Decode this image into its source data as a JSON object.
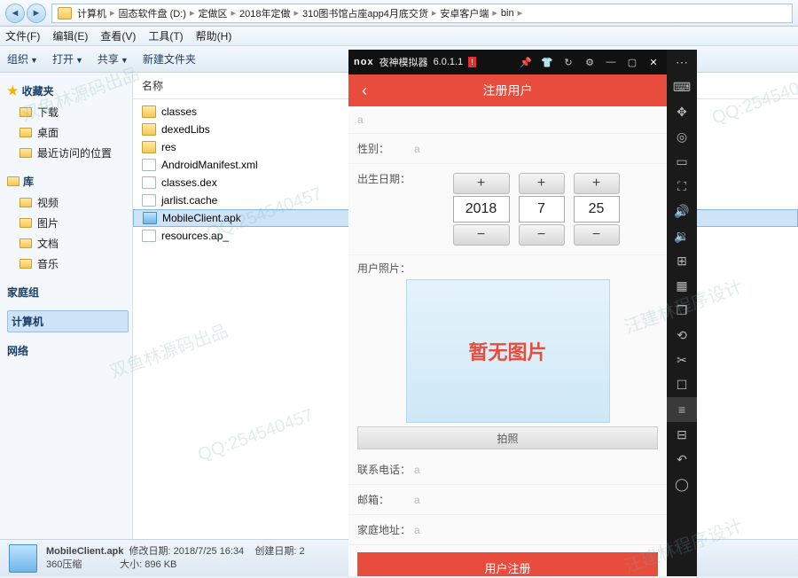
{
  "explorer": {
    "breadcrumbs": [
      "计算机",
      "固态软件盘 (D:)",
      "定做区",
      "2018年定做",
      "310图书馆占座app4月底交货",
      "安卓客户端",
      "bin"
    ],
    "menu": {
      "file": "文件(F)",
      "edit": "编辑(E)",
      "view": "查看(V)",
      "tools": "工具(T)",
      "help": "帮助(H)"
    },
    "toolbar": {
      "organize": "组织",
      "open": "打开",
      "share": "共享",
      "newfolder": "新建文件夹"
    },
    "sidebar": {
      "favorites": "收藏夹",
      "downloads": "下载",
      "desktop": "桌面",
      "recent": "最近访问的位置",
      "libraries": "库",
      "videos": "视频",
      "pictures": "图片",
      "documents": "文档",
      "music": "音乐",
      "homegroup": "家庭组",
      "computer": "计算机",
      "network": "网络"
    },
    "header": {
      "name": "名称"
    },
    "files": [
      {
        "name": "classes",
        "type": "folder"
      },
      {
        "name": "dexedLibs",
        "type": "folder"
      },
      {
        "name": "res",
        "type": "folder"
      },
      {
        "name": "AndroidManifest.xml",
        "type": "file"
      },
      {
        "name": "classes.dex",
        "type": "file"
      },
      {
        "name": "jarlist.cache",
        "type": "file"
      },
      {
        "name": "MobileClient.apk",
        "type": "apk",
        "selected": true
      },
      {
        "name": "resources.ap_",
        "type": "file"
      }
    ],
    "status": {
      "filename": "MobileClient.apk",
      "type": "360压缩",
      "mod_label": "修改日期:",
      "mod_value": "2018/7/25 16:34",
      "size_label": "大小:",
      "size_value": "896 KB",
      "create_label": "创建日期:"
    }
  },
  "emulator": {
    "titlebar": {
      "logo": "nox",
      "name": "夜神模拟器",
      "version": "6.0.1.1"
    },
    "app": {
      "title": "注册用户",
      "fields": {
        "gender_label": "性别：",
        "birth_label": "出生日期：",
        "photo_label": "用户照片：",
        "phone_label": "联系电话：",
        "email_label": "邮箱：",
        "address_label": "家庭地址："
      },
      "date": {
        "year": "2018",
        "month": "7",
        "day": "25"
      },
      "photo_placeholder": "暂无图片",
      "photo_button": "拍照",
      "register_button": "用户注册"
    }
  },
  "watermarks": {
    "a": "双鱼林源码出品",
    "b": "QQ:254540457",
    "c": "汪建林程序设计"
  }
}
